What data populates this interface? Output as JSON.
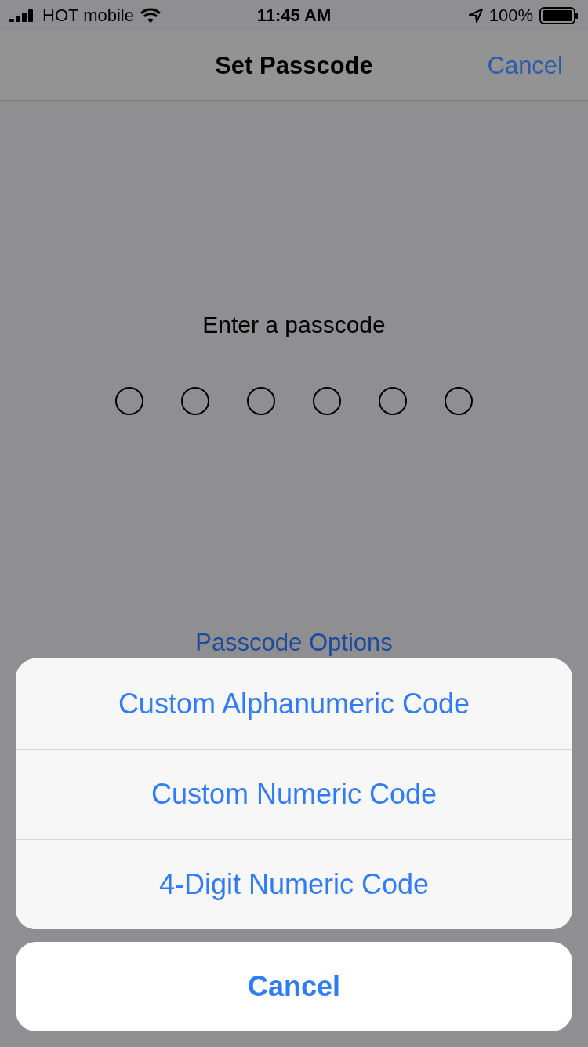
{
  "status_bar": {
    "carrier": "HOT mobile",
    "time": "11:45 AM",
    "battery": "100%"
  },
  "nav": {
    "title": "Set Passcode",
    "action": "Cancel"
  },
  "prompt": "Enter a passcode",
  "dots": [
    {
      "filled": false
    },
    {
      "filled": false
    },
    {
      "filled": false
    },
    {
      "filled": false
    },
    {
      "filled": false
    },
    {
      "filled": false
    }
  ],
  "options_link": "Passcode Options",
  "action_sheet": {
    "options": [
      "Custom Alphanumeric Code",
      "Custom Numeric Code",
      "4-Digit Numeric Code"
    ],
    "cancel": "Cancel"
  }
}
